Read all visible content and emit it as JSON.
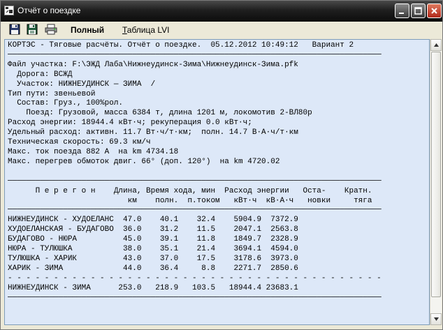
{
  "window": {
    "title": "Отчёт о поездке"
  },
  "toolbar": {
    "full_label": "Полный",
    "table_label_u": "Т",
    "table_label_rest": "аблица LVI"
  },
  "icons": {
    "save": "floppy-disk-icon",
    "save_as": "floppy-disk-alt-icon",
    "print": "printer-icon"
  },
  "report": {
    "lines": [
      "КОРТЭС - Тяговые расчёты. Отчёт о поездке.  05.12.2012 10:49:12   Вариант 2",
      "─────────────────────────────────────────────────────────────────────────────────",
      "Файл участка: F:\\ЭЖД Лаба\\Нижнеудинск-Зима\\Нижнеудинск-Зима.pfk",
      "  Дорога: ВСЖД",
      "  Участок: НИЖНЕУДИНСК — ЗИМА  /",
      "Тип пути: звеньевой",
      "  Состав: Груз., 100%рол.",
      "    Поезд: Грузовой, масса 6384 т, длина 1201 м, локомотив 2-ВЛ80р",
      "Расход энергии: 18944.4 кВт·ч; рекуперация 0.0 кВт·ч;",
      "Удельный расход: активн. 11.7 Вт·ч/т·км;  полн. 14.7 В·А·ч/т·км",
      "Техническая скорость: 69.3 км/ч",
      "Макс. ток поезда 882 А  на km 4734.18",
      "Макс. перегрев обмоток двиг. 66° (доп. 120°)  на km 4720.02",
      "",
      "─────────────────────────────────────────────────────────────────────────────────",
      "      П е р е г о н    Длина, Время хода, мин  Расход энергии   Оста-    Кратн.",
      "                          км    полн.  п.током   кВт·ч  кВ·А·ч   новки     тяга",
      "─────────────────────────────────────────────────────────────────────────────────",
      "НИЖНЕУДИНСК - ХУДОЕЛАНС  47.0    40.1    32.4    5904.9  7372.9",
      "ХУДОЕЛАНСКАЯ - БУДАГОВО  36.0    31.2    11.5    2047.1  2563.8",
      "БУДАГОВО - НЮРА          45.0    39.1    11.8    1849.7  2328.9",
      "НЮРА - ТУЛЮШКА           38.0    35.1    21.4    3694.1  4594.0",
      "ТУЛЮШКА - ХАРИК          43.0    37.0    17.5    3178.6  3973.0",
      "ХАРИК - ЗИМА             44.0    36.4     8.8    2271.7  2850.6",
      "- - - - - - - - - - - - - - - - - - - - - - - - - - - - - - - - - - - - - - - - -",
      "НИЖНЕУДИНСК - ЗИМА      253.0   218.9   103.5   18944.4 23683.1",
      "─────────────────────────────────────────────────────────────────────────────────"
    ]
  }
}
